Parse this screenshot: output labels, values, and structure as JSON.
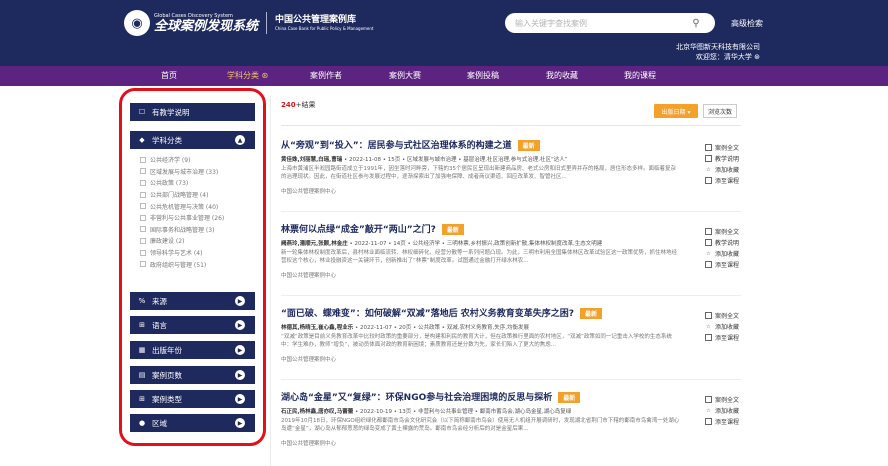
{
  "header": {
    "logo_en": "Global Cases Discovery System",
    "logo_cn": "全球案例发现系统",
    "library_cn": "中国公共管理案例库",
    "library_en": "China Case Bank for Public Policy & Management",
    "search_placeholder": "输入关键字查找案例",
    "advanced_search": "高级检索",
    "org_name": "北京华图新天科技有限公司",
    "welcome": "欢迎您：清华大学 ⊛"
  },
  "nav": {
    "items": [
      {
        "label": "首页"
      },
      {
        "label": "学科分类 ⊛"
      },
      {
        "label": "案例作者"
      },
      {
        "label": "案例大赛"
      },
      {
        "label": "案例投稿"
      },
      {
        "label": "我的收藏"
      },
      {
        "label": "我的课程"
      }
    ]
  },
  "sidebar": {
    "teaching_notes": "有教学说明",
    "subject": "学科分类",
    "subject_items": [
      {
        "label": "公共经济学 (9)"
      },
      {
        "label": "区域发展与城市治理 (33)"
      },
      {
        "label": "公共政策 (73)"
      },
      {
        "label": "公共部门战略管理 (4)"
      },
      {
        "label": "公共危机管理与决策 (40)"
      },
      {
        "label": "非营利与公共事业管理 (26)"
      },
      {
        "label": "国际事务和战略管理 (3)"
      },
      {
        "label": "廉政建设 (2)"
      },
      {
        "label": "领导科学与艺术 (4)"
      },
      {
        "label": "政府组织与管理 (51)"
      }
    ],
    "source": "来源",
    "language": "语言",
    "year": "出版年份",
    "pages": "案例页数",
    "type": "案例类型",
    "region": "区域"
  },
  "results": {
    "count_number": "240",
    "count_suffix": "+结果",
    "sort_label": "出版日期 ▾",
    "browse_label": "浏览次数"
  },
  "badge_label": "最新",
  "actions": {
    "fulltext": "案例全文",
    "teaching": "教学说明",
    "favorite": "添加收藏",
    "add_course": "添至课程"
  },
  "articles": [
    {
      "title": "从“旁观”到“投入”：居民参与式社区治理体系的构建之道",
      "authors": "黄佳姝,刘丽慧,白瑶,曹瑞",
      "meta": " • 2022-11-08 • 15页 • 区域发展与城市治理 • 基层治理,社区治理,参与式治理,社区“达人”",
      "abstract": "上海市黄浦区半淞园路街道成立于1991年，因坐落时河畔旁，下辖的35个居民区呈现出新建商品房、老式公房和旧式里弄并存的格局，居住形态多样。面临着复杂的治理现状。因此，在街道社区参与发展过程中，逐渐探索出了加强电保障、成者商议渠道、回应改革发、智管社区..."
    },
    {
      "title": "林票何以点绿“成金”敲开“两山”之门?",
      "authors": "阙燕玲,潘顺元,张颢,林金庄",
      "meta": " • 2022-11-07 • 14页 • 公共经济学 • 三明林票,乡村振兴,政策创新扩散,集体林权制度改革,生态文明建",
      "abstract": "新一轮集体林权制度改革后，县村林业面临流转、林权细碎化、经营分散等一系列问题凸现。为此，三明市利用全国集体林区改革试验区这一政策优势，抓住林地经营权这个核心，林业投融资这一关键环节，创新推出了“林票”制度改革。试图通过金融打开绿水林农..."
    },
    {
      "title": "“面已破、蝶难变”：如何破解“双减”落地后 农村义务教育变革失序之困?",
      "authors": "林德其,杨晴玉,崔心鑫,程业乐",
      "meta": " • 2022-11-07 • 20页 • 公共政策 • 双减,农村义务教育,失序,均衡发展",
      "abstract": "“双减”政策是目前义务教育改革中比较时政策的重要部分，是构建和利民的教育大计，但在政策推行里面的农村地区，“双减”政策如同一记重击入学校的生态系统中：学生难办，教师“增负”，被动员体面对政的教育新困境；素质教育还是分数为先，家长们陷入了更大的焦虑..."
    },
    {
      "title": "湖心岛“金星”又“复绿”：环保NGO参与社会治理困境的反思与探析",
      "authors": "石正民,杨林鑫,唐亦叹,马蕾蕾",
      "meta": " • 2022-10-19 • 13页 • 非营利与公共事业管理 • 鄱南市蓄鸟会,湖心岛金星,湖心岛复绿",
      "abstract": "2019年10月18日，环保NGO组织绿化都鄱南市鸟会文化研究会（以下简称鄱南市鸟会）使用无人机组开展调研时，发现湖北省荆门市下辖的鄱南市鸟禽湾一处湖心岛遭“金星”，湖心岛从郁郁葱葱的绿岛变成了黄土裸露的荒岛。鄱南市鸟会经分析后的对是金星后果..."
    }
  ],
  "article_source": "中国公共管理案例中心",
  "article_actions": [
    [
      "fulltext",
      "teaching",
      "favorite",
      "add_course"
    ],
    [
      "fulltext",
      "teaching",
      "favorite",
      "add_course"
    ],
    [
      "fulltext",
      "favorite",
      "add_course"
    ],
    [
      "fulltext",
      "favorite",
      "add_course"
    ]
  ]
}
